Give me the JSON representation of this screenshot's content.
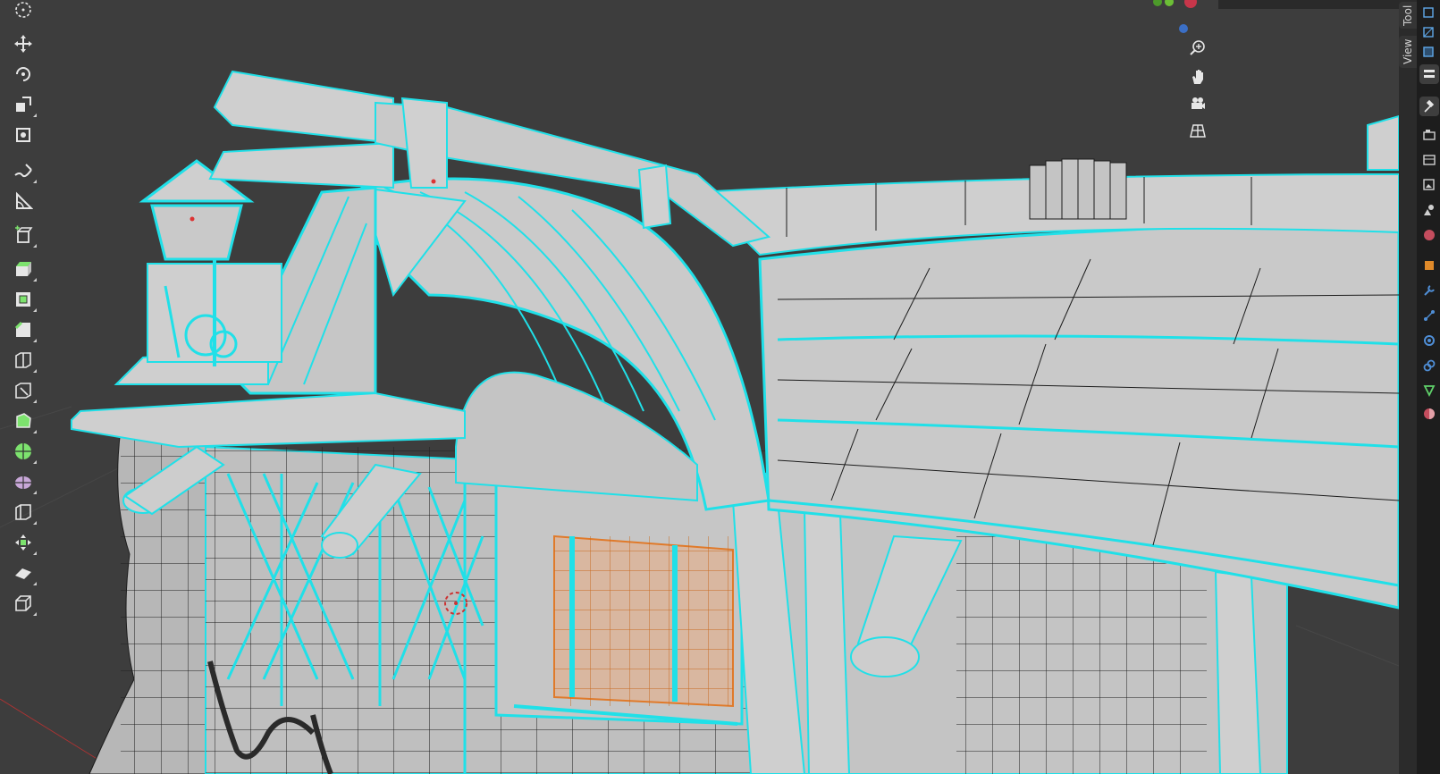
{
  "app": "Blender",
  "sidebar_tabs": {
    "tool": "Tool",
    "view": "View"
  },
  "toolbar": {
    "tools": [
      {
        "name": "cursor-icon",
        "active": false
      },
      {
        "name": "move-icon",
        "active": false
      },
      {
        "name": "rotate-icon",
        "active": false
      },
      {
        "name": "scale-icon",
        "active": false
      },
      {
        "name": "transform-icon",
        "active": false
      },
      {
        "name": "annotate-icon",
        "active": false
      },
      {
        "name": "measure-icon",
        "active": false
      },
      {
        "name": "add-cube-icon",
        "active": false
      },
      {
        "name": "extrude-region-icon",
        "active": false
      },
      {
        "name": "inset-faces-icon",
        "active": false
      },
      {
        "name": "bevel-icon",
        "active": false
      },
      {
        "name": "loop-cut-icon",
        "active": false
      },
      {
        "name": "knife-icon",
        "active": false
      },
      {
        "name": "poly-build-icon",
        "active": false
      },
      {
        "name": "spin-icon",
        "active": false
      },
      {
        "name": "smooth-icon",
        "active": false
      },
      {
        "name": "edge-slide-icon",
        "active": false
      },
      {
        "name": "shrink-fatten-icon",
        "active": false
      },
      {
        "name": "shear-icon",
        "active": false
      },
      {
        "name": "rip-region-icon",
        "active": false
      }
    ]
  },
  "navigation": [
    "zoom-icon",
    "hand-pan-icon",
    "camera-view-icon",
    "perspective-grid-icon"
  ],
  "properties_tabs": [
    "tool-properties-icon",
    "render-icon",
    "output-icon",
    "view-layer-icon",
    "scene-icon",
    "world-icon",
    "object-icon",
    "modifier-icon",
    "particles-icon",
    "physics-icon",
    "constraints-icon",
    "data-icon",
    "material-icon"
  ],
  "colors": {
    "viewport_bg": "#3d3d3d",
    "mesh_face": "#c8c8c8",
    "wire": "#1c1c1c",
    "selected_edge": "#20e0e8",
    "active_face": "#e8a070"
  }
}
